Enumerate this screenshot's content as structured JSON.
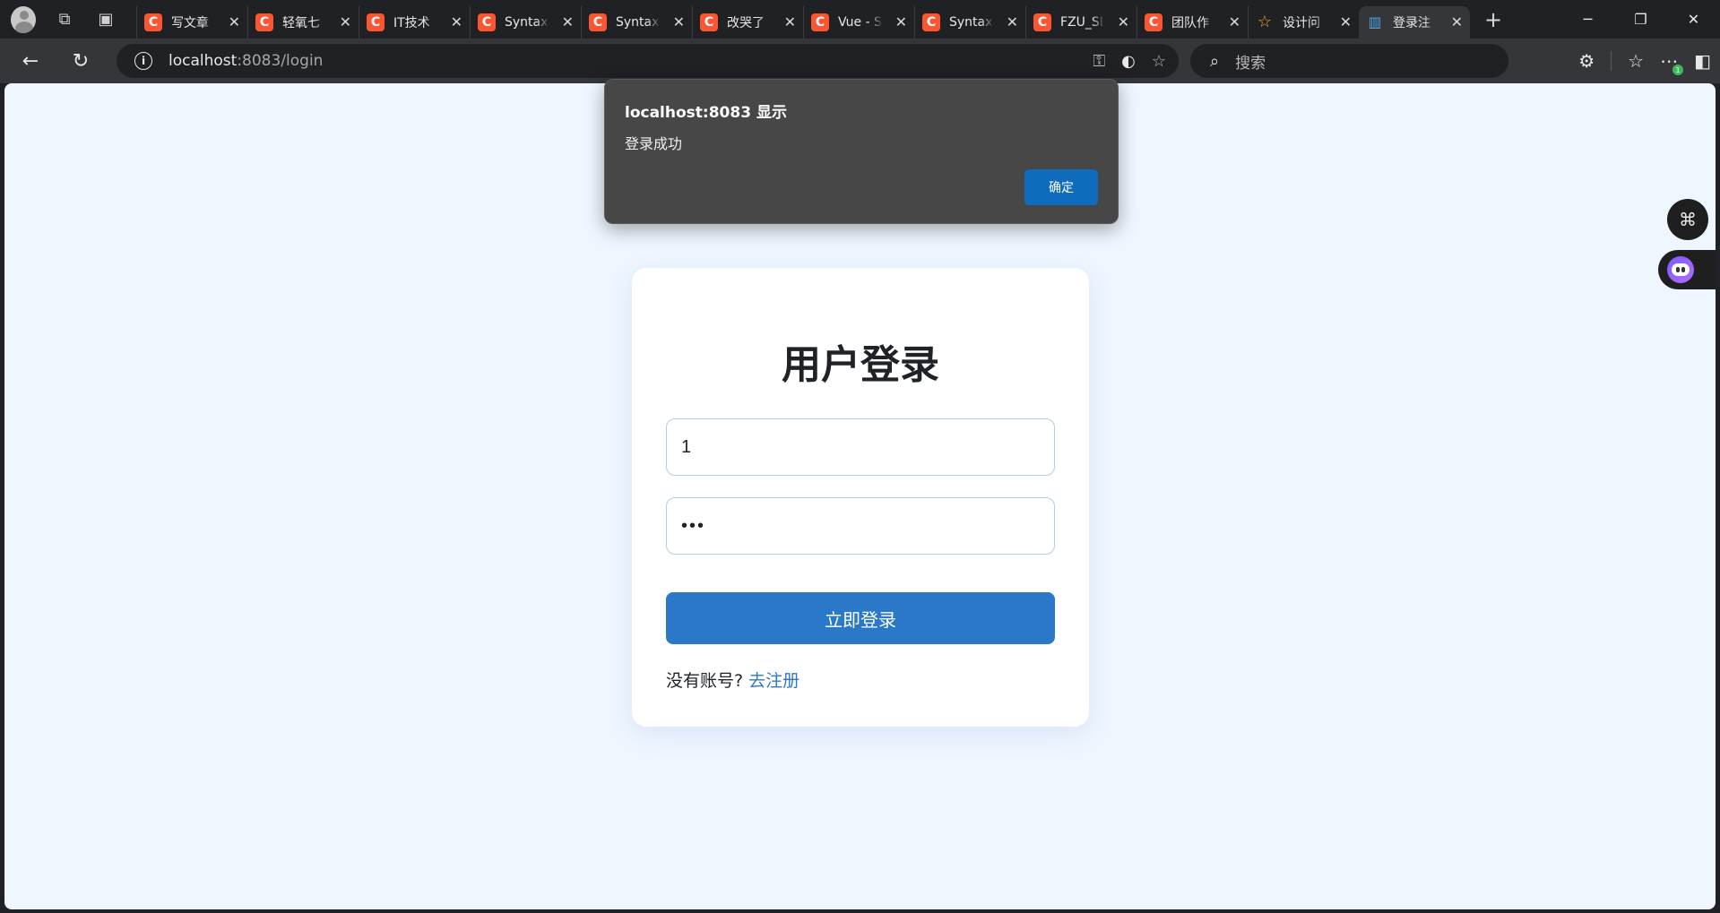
{
  "browser": {
    "tabs": [
      {
        "label": "写文章",
        "icon": "C",
        "kind": "csdn"
      },
      {
        "label": "轻氧七",
        "icon": "C",
        "kind": "csdn"
      },
      {
        "label": "IT技术",
        "icon": "C",
        "kind": "csdn"
      },
      {
        "label": "Syntax",
        "icon": "C",
        "kind": "csdn"
      },
      {
        "label": "Syntax",
        "icon": "C",
        "kind": "csdn"
      },
      {
        "label": "改哭了",
        "icon": "C",
        "kind": "csdn"
      },
      {
        "label": "Vue - S",
        "icon": "C",
        "kind": "csdn"
      },
      {
        "label": "Syntax",
        "icon": "C",
        "kind": "csdn"
      },
      {
        "label": "FZU_SI",
        "icon": "C",
        "kind": "csdn"
      },
      {
        "label": "团队作",
        "icon": "C",
        "kind": "csdn"
      },
      {
        "label": "设计问",
        "icon": "☆",
        "kind": "star"
      },
      {
        "label": "登录注",
        "icon": "▥",
        "kind": "blue",
        "active": true
      }
    ],
    "url_host": "localhost",
    "url_rest": ":8083/login",
    "search_placeholder": "搜索",
    "extensions_badge": "1"
  },
  "page": {
    "title": "用户登录",
    "username_value": "1",
    "password_value": "•••",
    "login_button": "立即登录",
    "register_prompt": "没有账号?",
    "register_link": "去注册"
  },
  "dialog": {
    "title": "localhost:8083 显示",
    "message": "登录成功",
    "ok_button": "确定"
  },
  "colors": {
    "primary": "#2b78c9",
    "page_bg": "#eff6ff",
    "dialog_bg": "#474747",
    "dialog_ok": "#0f6cbd",
    "csdn": "#fc5531"
  }
}
